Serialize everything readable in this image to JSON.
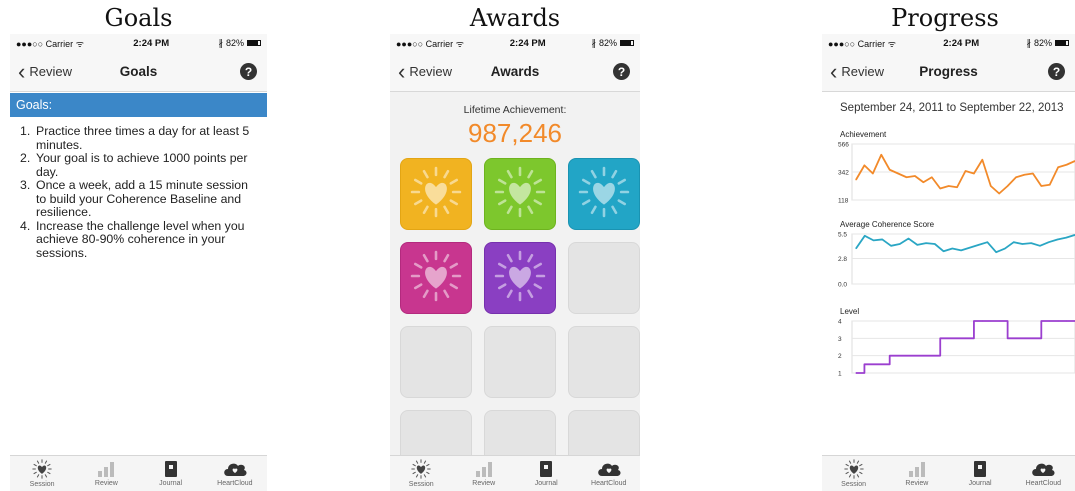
{
  "captions": {
    "goals": "Goals",
    "awards": "Awards",
    "progress": "Progress"
  },
  "status": {
    "carrier": "●●●○○ Carrier",
    "wifi": "ᯤ",
    "time": "2:24 PM",
    "bluetooth": "∦",
    "battery": "82%"
  },
  "nav": {
    "back_label": "Review",
    "help": "?"
  },
  "goals": {
    "title": "Goals",
    "header": "Goals:",
    "items": [
      {
        "num": "1.",
        "text": "Practice three times a day for at least 5 minutes."
      },
      {
        "num": "2.",
        "text": "Your goal is to achieve 1000 points per day."
      },
      {
        "num": "3.",
        "text": "Once a week, add a 15 minute session to build your Coherence Baseline and resilience."
      },
      {
        "num": "4.",
        "text": "Increase the challenge level when you achieve 80-90% coherence in your sessions."
      }
    ]
  },
  "awards": {
    "title": "Awards",
    "lifetime_label": "Lifetime Achievement:",
    "lifetime_value": "987,246",
    "tiles": [
      {
        "state": "earned",
        "color": "#f1b321",
        "icon": "heart-sun-icon"
      },
      {
        "state": "earned",
        "color": "#7dc72d",
        "icon": "heart-sun-icon"
      },
      {
        "state": "earned",
        "color": "#22a5c6",
        "icon": "heart-sun-icon"
      },
      {
        "state": "earned",
        "color": "#c8368f",
        "icon": "heart-sun-icon"
      },
      {
        "state": "earned",
        "color": "#8a3fc2",
        "icon": "heart-sun-icon"
      },
      {
        "state": "locked",
        "color": "#e4e4e4"
      },
      {
        "state": "locked",
        "color": "#e4e4e4"
      },
      {
        "state": "locked",
        "color": "#e4e4e4"
      },
      {
        "state": "locked",
        "color": "#e4e4e4"
      },
      {
        "state": "locked",
        "color": "#e4e4e4"
      },
      {
        "state": "locked",
        "color": "#e4e4e4"
      },
      {
        "state": "locked",
        "color": "#e4e4e4"
      }
    ]
  },
  "progress": {
    "title": "Progress",
    "date_range": "September 24, 2011 to September 22, 2013"
  },
  "tabs": [
    {
      "label": "Session",
      "icon": "heart-sun-icon"
    },
    {
      "label": "Review",
      "icon": "bar-chart-icon"
    },
    {
      "label": "Journal",
      "icon": "journal-icon"
    },
    {
      "label": "HeartCloud",
      "icon": "heart-cloud-icon"
    }
  ],
  "chart_data": [
    {
      "type": "line",
      "title": "Achievement",
      "color": "#f28a2a",
      "yticks": [
        "566",
        "342",
        "118"
      ],
      "ylim": [
        118,
        566
      ],
      "values": [
        280,
        395,
        330,
        480,
        360,
        330,
        300,
        310,
        260,
        300,
        210,
        230,
        220,
        350,
        330,
        440,
        230,
        170,
        230,
        300,
        320,
        330,
        230,
        240,
        380,
        400,
        430
      ]
    },
    {
      "type": "line",
      "title": "Average Coherence Score",
      "color": "#2aa6c4",
      "yticks": [
        "5.5",
        "2.8",
        "0.0"
      ],
      "ylim": [
        0,
        5.5
      ],
      "values": [
        3.9,
        5.3,
        4.8,
        4.9,
        4.2,
        4.4,
        5.0,
        4.3,
        4.5,
        4.4,
        3.6,
        3.9,
        3.7,
        4.0,
        4.3,
        4.6,
        3.5,
        3.9,
        4.6,
        4.4,
        4.5,
        4.2,
        4.6,
        4.9,
        5.1,
        5.4
      ]
    },
    {
      "type": "line",
      "title": "Level",
      "color": "#9b3fcf",
      "step": true,
      "yticks": [
        "4",
        "3",
        "2",
        "1"
      ],
      "ylim": [
        1,
        4
      ],
      "values": [
        1,
        1.5,
        1.5,
        1.5,
        2,
        2,
        2,
        2,
        2,
        2,
        3,
        3,
        3,
        3,
        4,
        4,
        4,
        4,
        3,
        3,
        3,
        3,
        4,
        4,
        4,
        4,
        4
      ]
    }
  ]
}
